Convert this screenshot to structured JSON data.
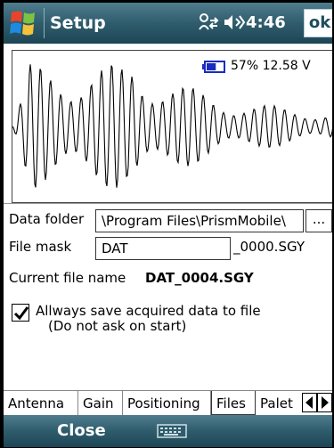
{
  "titlebar": {
    "title": "Setup",
    "clock": "4:46",
    "ok_label": "ok",
    "icons": [
      "windows-start-icon",
      "connectivity-icon",
      "volume-icon"
    ]
  },
  "wave_panel": {
    "battery_text": "57% 12.58 V",
    "battery_level": 0.57
  },
  "form": {
    "data_folder_label": "Data folder",
    "data_folder_value": "\\Program Files\\PrismMobile\\",
    "browse_label": "...",
    "file_mask_label": "File mask",
    "file_mask_value": "DAT",
    "file_mask_suffix": "_0000.SGY",
    "current_file_label": "Current file name",
    "current_file_value": "DAT_0004.SGY",
    "save_checkbox_checked": true,
    "save_line1": "Allways save acquired data to file",
    "save_line2": "(Do not ask on start)"
  },
  "tabs": {
    "items": [
      "Antenna",
      "Gain",
      "Positioning",
      "Files",
      "Palet"
    ],
    "active": "Files"
  },
  "bottombar": {
    "left_softkey": "Close",
    "icon": "keyboard-icon"
  },
  "colors": {
    "bar_dark": "#1d4656",
    "bar_light": "#4f7d8d",
    "battery_blue": "#1a2bbf",
    "ok_text": "#1d4e5e"
  }
}
